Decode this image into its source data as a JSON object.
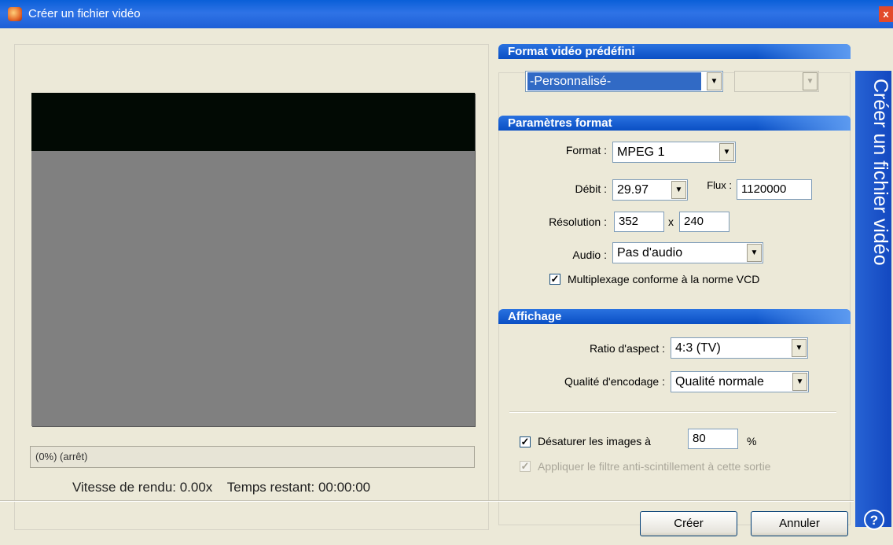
{
  "window": {
    "title": "Créer un fichier vidéo",
    "close_label": "x"
  },
  "side_title": "Créer un fichier vidéo",
  "preview": {
    "progress_text": "(0%) (arrêt)",
    "speed_text": "Vitesse de rendu: 0.00x",
    "remaining_text": "Temps restant: 00:00:00"
  },
  "preset": {
    "header": "Format vidéo prédéfini",
    "preset_value": "-Personnalisé-",
    "secondary_value": ""
  },
  "format_params": {
    "header": "Paramètres format",
    "format_label": "Format :",
    "format_value": "MPEG 1",
    "rate_label": "Débit :",
    "rate_value": "29.97",
    "flux_label": "Flux :",
    "flux_value": "1120000",
    "resolution_label": "Résolution :",
    "width_value": "352",
    "x_label": "x",
    "height_value": "240",
    "audio_label": "Audio :",
    "audio_value": "Pas d'audio",
    "vcd_checkbox_label": "Multiplexage conforme à la norme VCD",
    "vcd_checked": true
  },
  "display": {
    "header": "Affichage",
    "aspect_label": "Ratio d'aspect :",
    "aspect_value": "4:3 (TV)",
    "quality_label": "Qualité d'encodage :",
    "quality_value": "Qualité normale",
    "desaturate_label": "Désaturer les images à",
    "desaturate_value": "80",
    "percent_label": "%",
    "flicker_label": "Appliquer le filtre anti-scintillement à cette sortie"
  },
  "buttons": {
    "create": "Créer",
    "cancel": "Annuler",
    "help": "?"
  },
  "colors": {
    "titlebar": "#0a5fd8",
    "section_header": "#1f63d8",
    "side_band": "#1c55c8"
  }
}
